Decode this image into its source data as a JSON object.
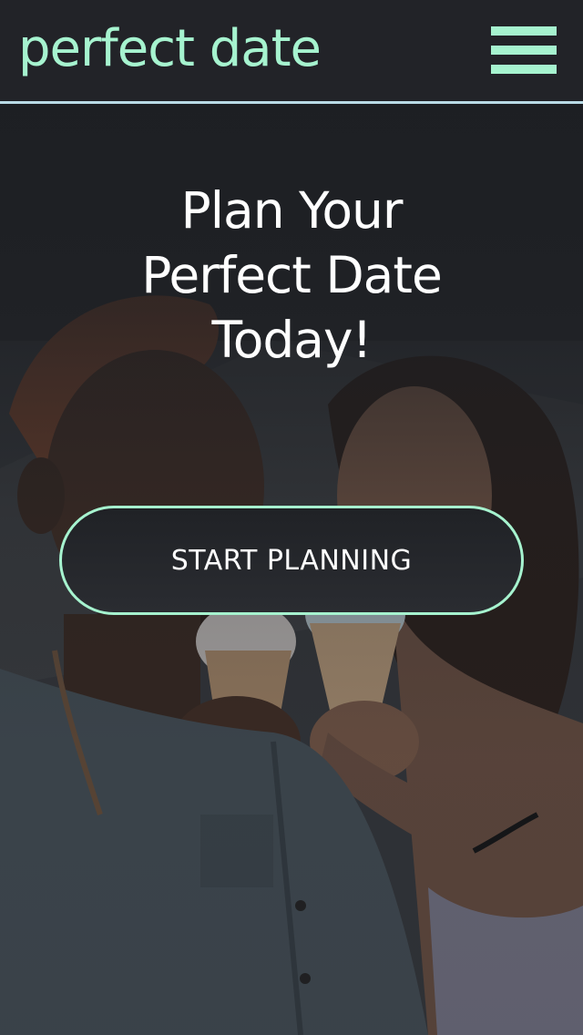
{
  "header": {
    "brand": "perfect date",
    "menu_icon": "hamburger-menu-icon"
  },
  "hero": {
    "headline": "Plan Your Perfect Date Today!",
    "cta_label": "START PLANNING",
    "image_alt": "couple sharing ice cream cones"
  },
  "colors": {
    "accent": "#a6f3cf",
    "header_bg": "#222328",
    "divider": "#b9dbe6",
    "text": "#ffffff"
  }
}
